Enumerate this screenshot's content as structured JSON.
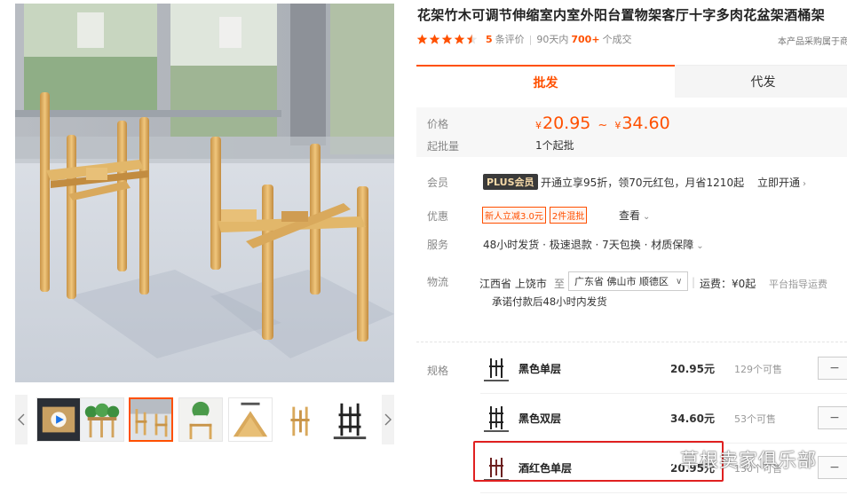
{
  "product": {
    "title": "花架竹木可调节伸缩室内室外阳台置物架客厅十字多肉花盆架酒桶架"
  },
  "rating": {
    "stars": 4.5,
    "review_count": "5",
    "review_label": "条评价",
    "period_label": "90天内",
    "sold_count": "700+",
    "sold_label": "个成交",
    "right_note": "本产品采购属于商"
  },
  "tabs": [
    {
      "label": "批发",
      "active": true
    },
    {
      "label": "代发",
      "active": false
    }
  ],
  "price": {
    "label": "价格",
    "currency": "¥",
    "min": "20.95",
    "max": "34.60",
    "tilde": "~",
    "moq_label": "起批量",
    "moq_value": "1个起批"
  },
  "member": {
    "label": "会员",
    "badge": "PLUS会员",
    "text": "开通立享95折，领70元红包，月省1210起",
    "link": "立即开通",
    "link_arrow": "›"
  },
  "discount": {
    "label": "优惠",
    "tags": [
      "新人立减3.0元",
      "2件混批"
    ],
    "link": "查看",
    "link_arrow": "⌄"
  },
  "service": {
    "label": "服务",
    "text": "48小时发货 · 极速退款 · 7天包换 · 材质保障",
    "arrow": "⌄"
  },
  "logistics": {
    "label": "物流",
    "from": "江西省  上饶市",
    "to_word": "至",
    "dest": "广东省 佛山市 顺德区",
    "dest_arrow": "∨",
    "sep": "|",
    "freight": "运费：¥0起",
    "guide": "平台指导运费",
    "promise": "承诺付款后48小时内发货"
  },
  "sku": {
    "label": "规格",
    "items": [
      {
        "name": "黑色单层",
        "price": "20.95元",
        "stock": "129个可售",
        "minus": "−"
      },
      {
        "name": "黑色双层",
        "price": "34.60元",
        "stock": "53个可售",
        "minus": "−"
      },
      {
        "name": "酒红色单层",
        "price": "20.95元",
        "stock": "130个可售",
        "minus": "−"
      }
    ]
  },
  "gallery": {
    "left_arrow": "‹",
    "right_arrow": "›",
    "active_index": 2
  },
  "watermark": "草根卖家俱乐部",
  "colors": {
    "accent": "#ff5000",
    "highlight": "#e02020",
    "bamboo": "#d9a95c"
  }
}
